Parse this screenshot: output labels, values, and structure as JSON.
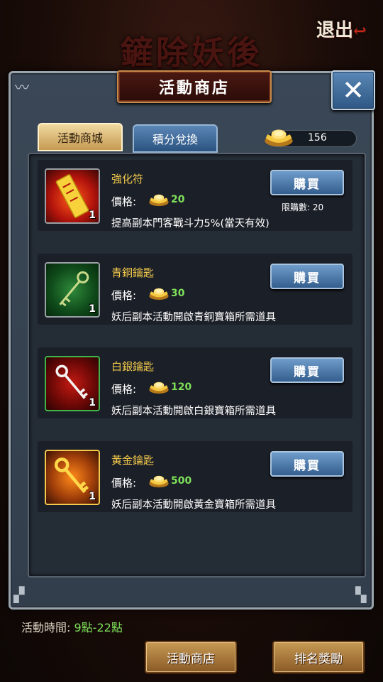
{
  "background": {
    "title": "鏟除妖後"
  },
  "header": {
    "exit_label": "退出"
  },
  "dialog": {
    "title": "活動商店",
    "tabs": [
      {
        "label": "活動商城",
        "active": true
      },
      {
        "label": "積分兌換",
        "active": false
      }
    ],
    "currency": {
      "icon": "gold-ingot-icon",
      "amount": "156"
    },
    "items": [
      {
        "name": "強化符",
        "icon": "talisman-icon",
        "quantity": "1",
        "price_label": "價格:",
        "price": "20",
        "description": "提高副本門客戰斗力5%(當天有效)",
        "buy_label": "購買",
        "limit": "限購數: 20"
      },
      {
        "name": "青銅鑰匙",
        "icon": "bronze-key-icon",
        "quantity": "1",
        "price_label": "價格:",
        "price": "30",
        "description": "妖后副本活動開啟青銅寶箱所需道具",
        "buy_label": "購買"
      },
      {
        "name": "白銀鑰匙",
        "icon": "silver-key-icon",
        "quantity": "1",
        "price_label": "價格:",
        "price": "120",
        "description": "妖后副本活動開啟白銀寶箱所需道具",
        "buy_label": "購買"
      },
      {
        "name": "黃金鑰匙",
        "icon": "gold-key-icon",
        "quantity": "1",
        "price_label": "價格:",
        "price": "500",
        "description": "妖后副本活動開啟黃金寶箱所需道具",
        "buy_label": "購買"
      }
    ]
  },
  "footer": {
    "time_label": "活動時間:",
    "time_value": "9點-22點",
    "shop_button": "活動商店",
    "ranking_button": "排名獎勵"
  },
  "colors": {
    "price_green": "#7ee05a",
    "item_name_gold": "#f2c94c",
    "button_blue": "#335e8e"
  }
}
